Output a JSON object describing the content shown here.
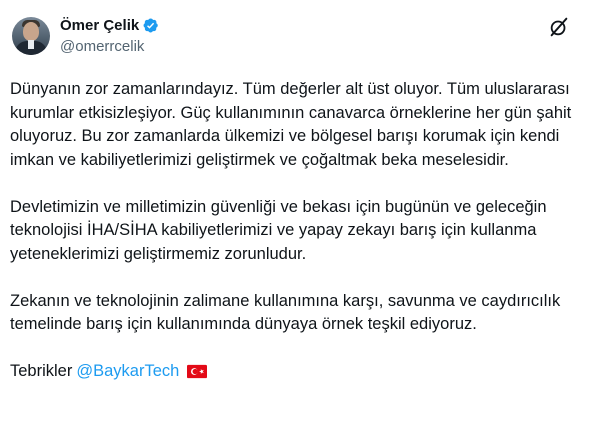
{
  "author": {
    "display_name": "Ömer Çelik",
    "handle": "@omerrcelik",
    "avatar_icon": "profile-photo",
    "verified_icon": "verified-badge-icon",
    "verified_color": "#1d9bf0"
  },
  "actions": {
    "grok_icon": "grok-icon"
  },
  "post": {
    "paragraphs": [
      "Dünyanın zor zamanlarındayız. Tüm değerler alt üst oluyor. Tüm uluslararası kurumlar etkisizleşiyor. Güç kullanımının canavarca örneklerine her gün şahit oluyoruz. Bu zor zamanlarda ülkemizi ve bölgesel barışı korumak için kendi imkan ve kabiliyetlerimizi geliştirmek ve çoğaltmak beka meselesidir.",
      "Devletimizin ve milletimizin güvenliği ve bekası için bugünün ve geleceğin teknolojisi İHA/SİHA kabiliyetlerimizi ve yapay zekayı barış için kullanma yeteneklerimizi geliştirmemiz zorunludur.",
      "Zekanın ve teknolojinin zalimane kullanımına karşı, savunma ve caydırıcılık temelinde barış için kullanımında dünyaya örnek teşkil ediyoruz."
    ],
    "closing_text": "Tebrikler",
    "mention": "@BaykarTech",
    "flag_icon": "turkey-flag-icon",
    "link_color": "#1d9bf0"
  }
}
